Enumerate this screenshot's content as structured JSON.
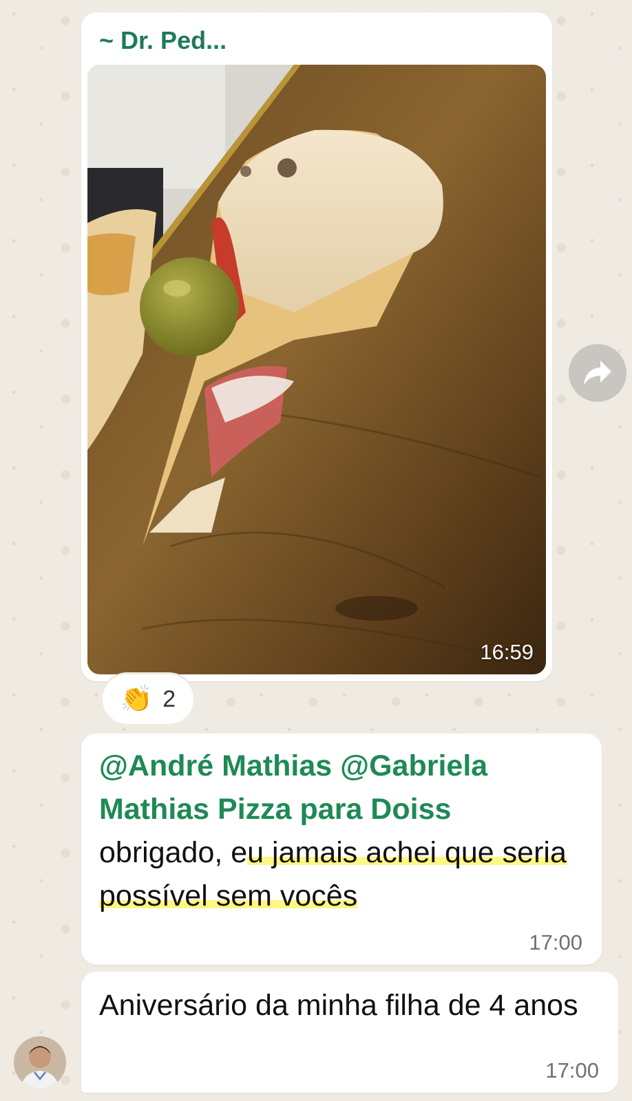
{
  "image_message": {
    "sender": "~ Dr. Ped...",
    "time": "16:59",
    "photo_alt": "pizza-slice-photo",
    "reaction": {
      "emoji": "👏",
      "count": "2"
    }
  },
  "text_message": {
    "mention1": "@André Mathias",
    "mention2": "@Gabriela Mathias Pizza para Doiss",
    "body_plain": "obrigado, e",
    "body_highlight": "u jamais achei que seria possível sem vocês",
    "time": "17:00"
  },
  "last_message": {
    "text": "Aniversário da minha filha de 4 anos",
    "time": "17:00"
  },
  "icons": {
    "forward": "forward-arrow-icon",
    "avatar": "user-avatar"
  }
}
